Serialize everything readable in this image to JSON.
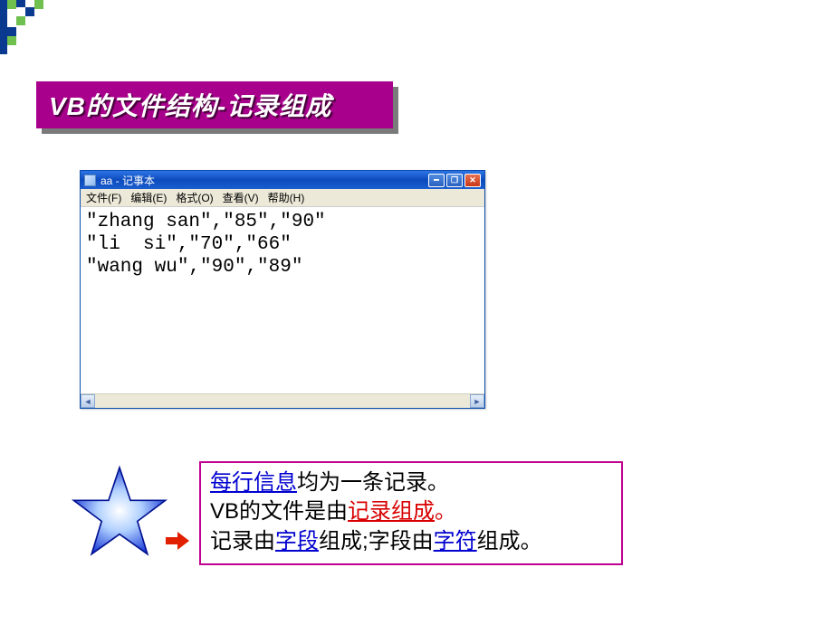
{
  "title": "VB的文件结构-记录组成",
  "notepad": {
    "window_title": "aa - 记事本",
    "menus": {
      "file": "文件(F)",
      "edit": "编辑(E)",
      "format": "格式(O)",
      "view": "查看(V)",
      "help": "帮助(H)"
    },
    "content": "\"zhang san\",\"85\",\"90\"\n\"li  si\",\"70\",\"66\"\n\"wang wu\",\"90\",\"89\""
  },
  "explain": {
    "l1a": "每行信息",
    "l1b": "均为一条记录。",
    "l2a": "VB的文件是由",
    "l2b": "记录组成",
    "l2c": "。",
    "l3a": "记录由",
    "l3b": "字段",
    "l3c": "组成;字段由",
    "l3d": "字符",
    "l3e": "组成。"
  }
}
